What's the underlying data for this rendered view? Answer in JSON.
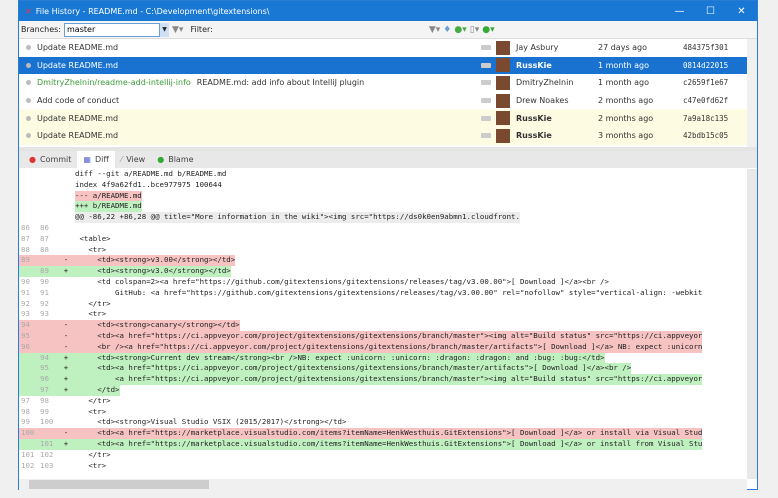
{
  "window": {
    "title": "File History - README.md - C:\\Development\\gitextensions\\",
    "minimize": "—",
    "maximize": "☐",
    "close": "✕"
  },
  "toolbar": {
    "branches_label": "Branches:",
    "branches_value": "master",
    "filter_label": "Filter:"
  },
  "commits": [
    {
      "message": "Update README.md",
      "branch": "",
      "author": "Jay Asbury",
      "bold": false,
      "date": "27 days ago",
      "hash": "484375f301",
      "state": "normal"
    },
    {
      "message": "Update README.md",
      "branch": "",
      "author": "RussKie",
      "bold": true,
      "date": "1 month ago",
      "hash": "0814d22015",
      "state": "selected"
    },
    {
      "message": "README.md: add info about IntelliJ plugin",
      "branch": "DmitryZhelnin/readme-add-intellij-info",
      "author": "DmitryZhelnin",
      "bold": false,
      "date": "1 month ago",
      "hash": "c2659f1e67",
      "state": "normal"
    },
    {
      "message": "Add code of conduct",
      "branch": "",
      "author": "Drew Noakes",
      "bold": false,
      "date": "2 months ago",
      "hash": "c47e0fd62f",
      "state": "normal"
    },
    {
      "message": "Update README.md",
      "branch": "",
      "author": "RussKie",
      "bold": true,
      "date": "2 months ago",
      "hash": "7a9a18c135",
      "state": "yellow"
    },
    {
      "message": "Update README.md",
      "branch": "",
      "author": "RussKie",
      "bold": true,
      "date": "3 months ago",
      "hash": "42bdb15c05",
      "state": "yellow"
    }
  ],
  "tabs": [
    {
      "label": "Commit",
      "icon": "commit-icon"
    },
    {
      "label": "Diff",
      "icon": "diff-icon",
      "active": true
    },
    {
      "label": "View",
      "icon": "view-icon"
    },
    {
      "label": "Blame",
      "icon": "blame-icon"
    }
  ],
  "diff": [
    {
      "o": "",
      "n": "",
      "m": "",
      "t": "diff --git a/README.md b/README.md",
      "k": "ctx"
    },
    {
      "o": "",
      "n": "",
      "m": "",
      "t": "index 4f9a62fd1..bce977975 100644",
      "k": "ctx"
    },
    {
      "o": "",
      "n": "",
      "m": "",
      "t": "--- a/README.md",
      "k": "hrem"
    },
    {
      "o": "",
      "n": "",
      "m": "",
      "t": "+++ b/README.md",
      "k": "hadd"
    },
    {
      "o": "",
      "n": "",
      "m": "",
      "t": "@@ -86,22 +86,28 @@ title=\"More information in the wiki\"><img src=\"https://ds0k0en9abmn1.cloudfront.",
      "k": "hunk"
    },
    {
      "o": "86",
      "n": "86",
      "m": "",
      "t": "",
      "k": "ctx"
    },
    {
      "o": "87",
      "n": "87",
      "m": "",
      "t": " <table>",
      "k": "ctx"
    },
    {
      "o": "88",
      "n": "88",
      "m": "",
      "t": "   <tr>",
      "k": "ctx"
    },
    {
      "o": "89",
      "n": "",
      "m": "-",
      "t": "     <td><strong>v3.00</strong></td>",
      "k": "rem"
    },
    {
      "o": "",
      "n": "89",
      "m": "+",
      "t": "     <td><strong>v3.0</strong></td>",
      "k": "add"
    },
    {
      "o": "90",
      "n": "90",
      "m": "",
      "t": "     <td colspan=2><a href=\"https://github.com/gitextensions/gitextensions/releases/tag/v3.00.00\">[ Download ]</a><br />",
      "k": "ctx"
    },
    {
      "o": "91",
      "n": "91",
      "m": "",
      "t": "         GitHub: <a href=\"https://github.com/gitextensions/gitextensions/releases/tag/v3.00.00\" rel=\"nofollow\" style=\"vertical-align: -webkit",
      "k": "ctx"
    },
    {
      "o": "92",
      "n": "92",
      "m": "",
      "t": "   </tr>",
      "k": "ctx"
    },
    {
      "o": "93",
      "n": "93",
      "m": "",
      "t": "   <tr>",
      "k": "ctx"
    },
    {
      "o": "94",
      "n": "",
      "m": "-",
      "t": "     <td><strong>canary</strong></td>",
      "k": "rem"
    },
    {
      "o": "95",
      "n": "",
      "m": "-",
      "t": "     <td><a href=\"https://ci.appveyor.com/project/gitextensions/gitextensions/branch/master\"><img alt=\"Build status\" src=\"https://ci.appveyor",
      "k": "rem"
    },
    {
      "o": "96",
      "n": "",
      "m": "-",
      "t": "     <br /><a href=\"https://ci.appveyor.com/project/gitextensions/gitextensions/branch/master/artifacts\">[ Download ]</a> NB: expect :unicorn",
      "k": "rem"
    },
    {
      "o": "",
      "n": "94",
      "m": "+",
      "t": "     <td><strong>Current dev stream</strong><br />NB: expect :unicorn: :unicorn: :dragon: :dragon: and :bug: :bug:</td>",
      "k": "add"
    },
    {
      "o": "",
      "n": "95",
      "m": "+",
      "t": "     <td><a href=\"https://ci.appveyor.com/project/gitextensions/gitextensions/branch/master/artifacts\">[ Download ]</a><br />",
      "k": "add"
    },
    {
      "o": "",
      "n": "96",
      "m": "+",
      "t": "         <a href=\"https://ci.appveyor.com/project/gitextensions/gitextensions/branch/master\"><img alt=\"Build status\" src=\"https://ci.appveyor",
      "k": "add"
    },
    {
      "o": "",
      "n": "97",
      "m": "+",
      "t": "     </td>",
      "k": "add"
    },
    {
      "o": "97",
      "n": "98",
      "m": "",
      "t": "   </tr>",
      "k": "ctx"
    },
    {
      "o": "98",
      "n": "99",
      "m": "",
      "t": "   <tr>",
      "k": "ctx"
    },
    {
      "o": "99",
      "n": "100",
      "m": "",
      "t": "     <td><strong>Visual Studio VSIX (2015/2017)</strong></td>",
      "k": "ctx"
    },
    {
      "o": "100",
      "n": "",
      "m": "-",
      "t": "     <td><a href=\"https://marketplace.visualstudio.com/items?itemName=HenkWesthuis.GitExtensions\">[ Download ]</a> or install via Visual Stud",
      "k": "rem"
    },
    {
      "o": "",
      "n": "101",
      "m": "+",
      "t": "     <td><a href=\"https://marketplace.visualstudio.com/items?itemName=HenkWesthuis.GitExtensions\">[ Download ]</a> or install from Visual Stu",
      "k": "add"
    },
    {
      "o": "101",
      "n": "102",
      "m": "",
      "t": "   </tr>",
      "k": "ctx"
    },
    {
      "o": "102",
      "n": "103",
      "m": "",
      "t": "   <tr>",
      "k": "ctx"
    }
  ],
  "colors": {
    "accent": "#1978d4",
    "removed": "#f6c2c2",
    "added": "#bff0bf",
    "branch": "#3a9a3a"
  }
}
